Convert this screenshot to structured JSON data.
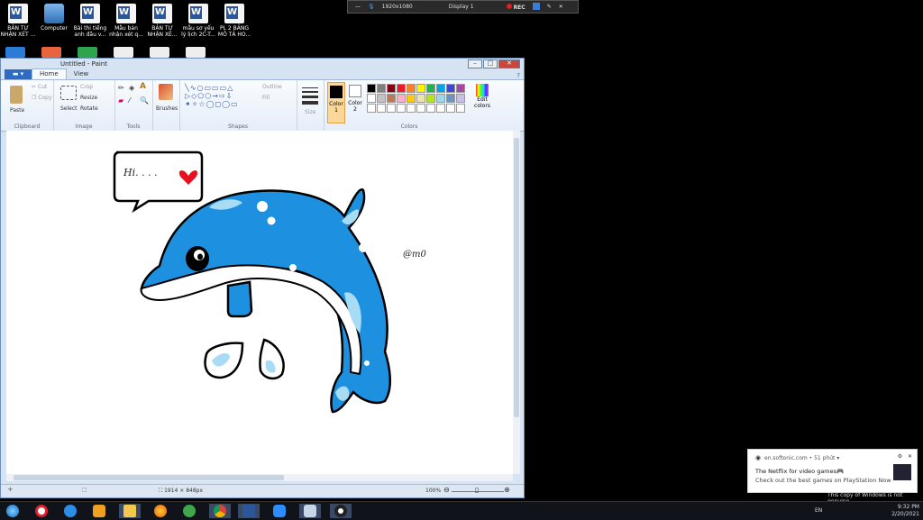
{
  "desktop": {
    "icons": [
      {
        "label": "BẢN TỰ\nNHẬN XÉT ...",
        "kind": "word"
      },
      {
        "label": "Computer",
        "kind": "pc"
      },
      {
        "label": "Bài thi tiếng\nanh đầu v...",
        "kind": "word"
      },
      {
        "label": "Mẫu bản\nnhận xét q...",
        "kind": "word"
      },
      {
        "label": "BẢN TỰ\nNHẬN XÉ...",
        "kind": "word"
      },
      {
        "label": "mẫu sơ yếu\nlý lịch 2C-T...",
        "kind": "word"
      },
      {
        "label": "PL 2 BẢNG\nMÔ TẢ HO...",
        "kind": "word"
      }
    ]
  },
  "recorder": {
    "resolution": "1920x1080",
    "display": "Display 1",
    "rec_label": "REC"
  },
  "paint": {
    "title": "Untitled - Paint",
    "tabs": {
      "file": "▬ ▾",
      "home": "Home",
      "view": "View"
    },
    "ribbon": {
      "paste": "Paste",
      "cut": "Cut",
      "copy": "Copy",
      "clipboard": "Clipboard",
      "select": "Select",
      "crop": "Crop",
      "resize": "Resize",
      "rotate": "Rotate",
      "image": "Image",
      "tools": "Tools",
      "brushes": "Brushes",
      "outline": "Outline",
      "fill": "Fill",
      "shapes": "Shapes",
      "size": "Size",
      "color1": "Color\n1",
      "color2": "Color\n2",
      "edit_colors": "Edit\ncolors",
      "colors": "Colors"
    },
    "palette": [
      "#000000",
      "#7f7f7f",
      "#880015",
      "#ed1c24",
      "#ff7f27",
      "#fff200",
      "#22b14c",
      "#00a2e8",
      "#3f48cc",
      "#a349a4",
      "#ffffff",
      "#c3c3c3",
      "#b97a57",
      "#ffaec9",
      "#ffc90e",
      "#efe4b0",
      "#b5e61d",
      "#99d9ea",
      "#7092be",
      "#c8bfe7",
      "#ffffff",
      "#ffffff",
      "#ffffff",
      "#ffffff",
      "#ffffff",
      "#ffffff",
      "#ffffff",
      "#ffffff",
      "#ffffff",
      "#ffffff"
    ],
    "drawing": {
      "speech": "Hi. . . .",
      "signature": "@m0"
    },
    "status": {
      "dimensions": "1914 × 848px",
      "zoom": "100%"
    }
  },
  "notification": {
    "source": "en.softonic.com • 51 phút ▾",
    "headline": "The Netflix for video games🎮",
    "body": "Check out the best games on PlayStation Now"
  },
  "watermark": "This copy of Windows is not genuine",
  "taskbar": {
    "lang": "EN",
    "time": "9:32 PM",
    "date": "2/20/2021"
  },
  "colors": {
    "accent": "#2e6bc5",
    "dolphin": "#1e90e0",
    "dolphin_light": "#a8dcf5",
    "heart": "#e8101e"
  }
}
